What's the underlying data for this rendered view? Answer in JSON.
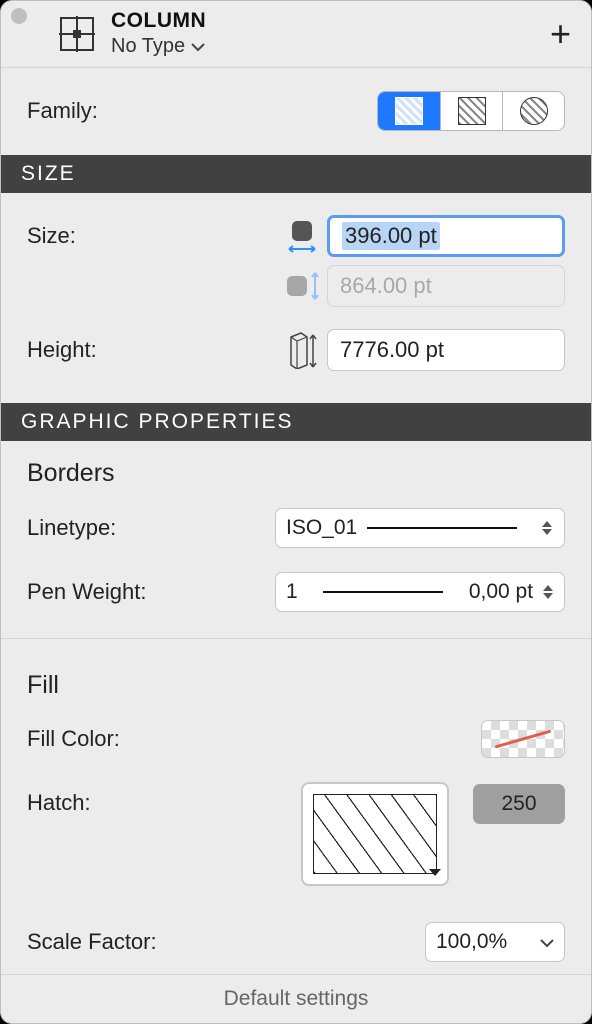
{
  "header": {
    "title": "COLUMN",
    "subtitle": "No Type"
  },
  "family": {
    "label": "Family:"
  },
  "sections": {
    "size_hdr": "SIZE",
    "graphic_hdr": "GRAPHIC PROPERTIES"
  },
  "size": {
    "label": "Size:",
    "width_value": "396.00 pt",
    "depth_value": "864.00 pt",
    "height_label": "Height:",
    "height_value": "7776.00 pt"
  },
  "borders": {
    "title": "Borders",
    "linetype_label": "Linetype:",
    "linetype_value": "ISO_01",
    "penweight_label": "Pen Weight:",
    "penweight_value_left": "1",
    "penweight_value_right": "0,00 pt"
  },
  "fill": {
    "title": "Fill",
    "color_label": "Fill Color:",
    "hatch_label": "Hatch:",
    "hatch_badge": "250",
    "scale_label": "Scale Factor:",
    "scale_value": "100,0%"
  },
  "footer": {
    "text": "Default settings"
  }
}
